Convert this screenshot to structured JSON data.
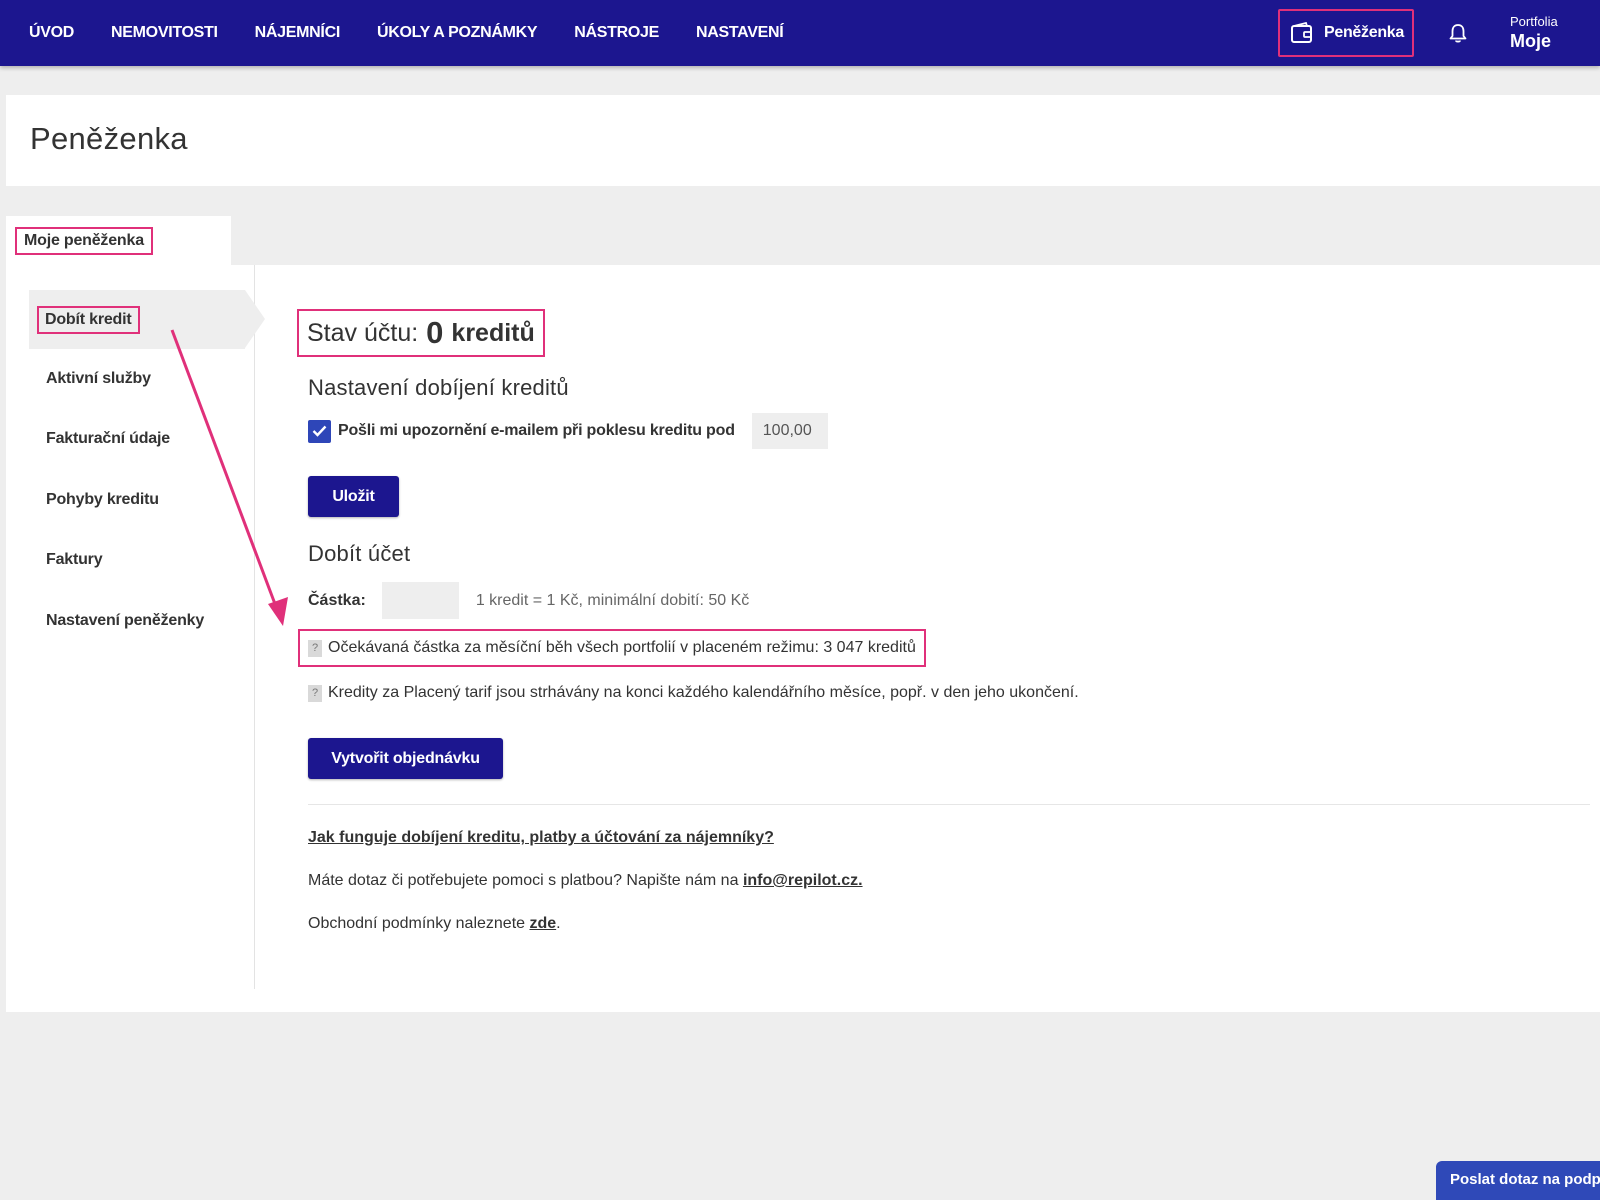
{
  "nav": {
    "items": [
      "ÚVOD",
      "NEMOVITOSTI",
      "NÁJEMNÍCI",
      "ÚKOLY A POZNÁMKY",
      "NÁSTROJE",
      "NASTAVENÍ"
    ],
    "wallet_label": "Peněženka",
    "portfolio_label": "Portfolia",
    "portfolio_value": "Moje"
  },
  "page": {
    "title": "Peněženka"
  },
  "tab": {
    "label": "Moje peněženka"
  },
  "sidebar": {
    "items": [
      {
        "label": "Dobít kredit"
      },
      {
        "label": "Aktivní služby"
      },
      {
        "label": "Fakturační údaje"
      },
      {
        "label": "Pohyby kreditu"
      },
      {
        "label": "Faktury"
      },
      {
        "label": "Nastavení peněženky"
      }
    ],
    "active_index": 0
  },
  "balance": {
    "prefix": "Stav účtu:",
    "amount": "0",
    "unit": "kreditů"
  },
  "topup_settings": {
    "heading": "Nastavení dobíjení kreditů",
    "checkbox_label": "Pošli mi upozornění e-mailem při poklesu kreditu pod",
    "checkbox_checked": true,
    "threshold_value": "100,00",
    "save_label": "Uložit"
  },
  "topup": {
    "heading": "Dobít účet",
    "amount_label": "Částka:",
    "amount_value": "",
    "hint": "1 kredit = 1 Kč, minimální dobití: 50 Kč",
    "expected_note": "Očekávaná částka za měsíční běh všech portfolií v placeném režimu: 3 047 kreditů",
    "billing_note": "Kredity za Placený tarif jsou strhávány na konci každého kalendářního měsíce, popř. v den jeho ukončení.",
    "help_mark": "?",
    "order_label": "Vytvořit objednávku"
  },
  "footer": {
    "faq_link": "Jak funguje dobíjení kreditu, platby a účtování za nájemníky?",
    "contact_text": "Máte dotaz či potřebujete pomoci s platbou? Napište nám na",
    "contact_email": "info@repilot.cz.",
    "terms_text": "Obchodní podmínky naleznete",
    "terms_link": "zde",
    "terms_end": "."
  },
  "help_button": {
    "label": "Poslat dotaz na podporu"
  },
  "icons": {
    "wallet": "wallet-icon",
    "bell": "bell-icon",
    "check": "check-icon",
    "help": "question-icon"
  },
  "colors": {
    "navbar": "#1c168f",
    "highlight": "#e0307a",
    "button": "#1c168f",
    "checkbox": "#2e46b8",
    "help_button": "#2f49b8"
  }
}
